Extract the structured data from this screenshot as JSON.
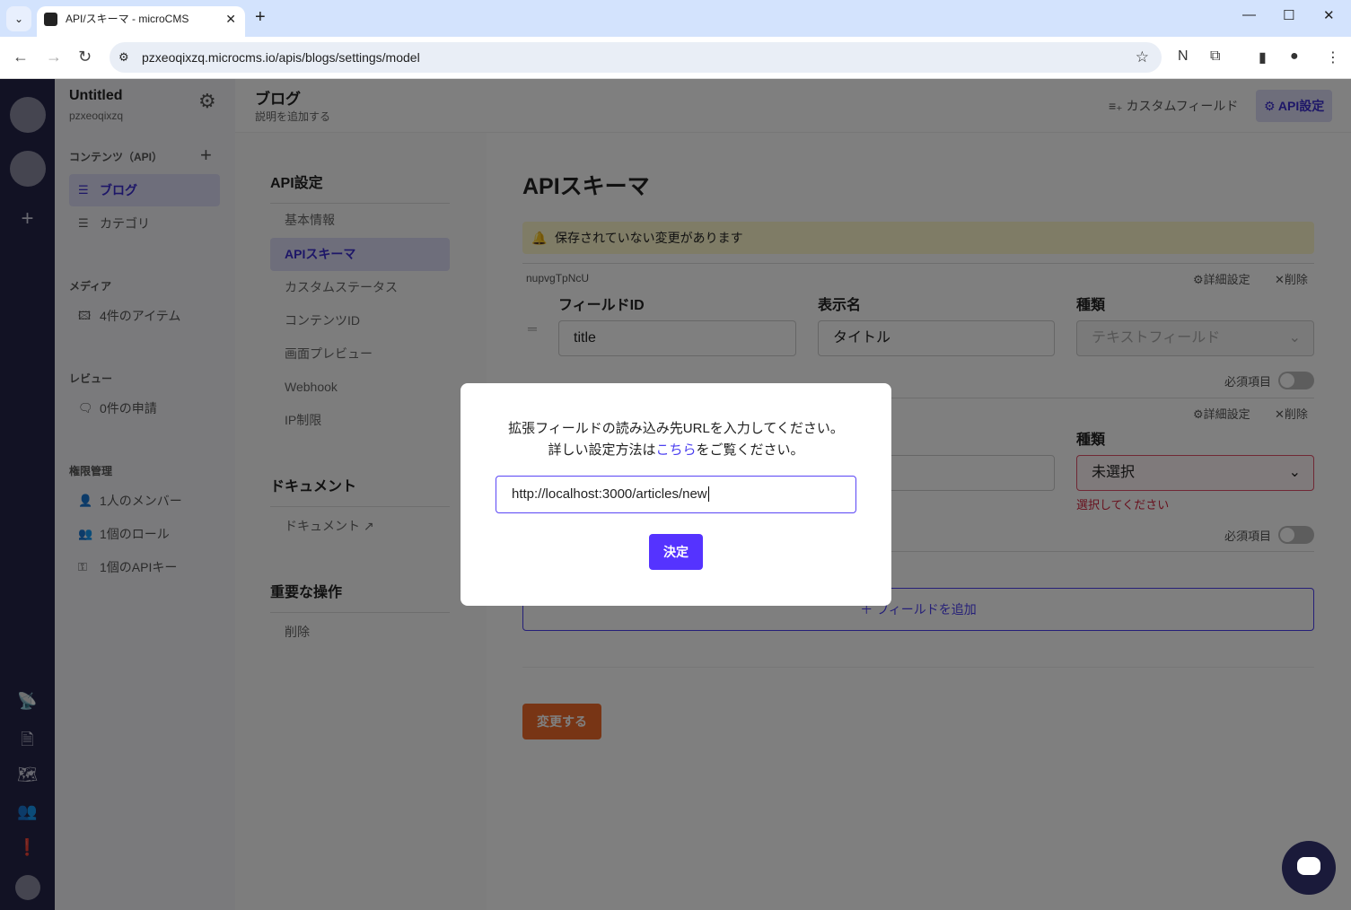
{
  "browser": {
    "tab_title": "API/スキーマ - microCMS",
    "url": "pzxeoqixzq.microcms.io/apis/blogs/settings/model"
  },
  "service": {
    "name": "Untitled",
    "id": "pzxeoqixzq"
  },
  "sidebar": {
    "contents_label": "コンテンツ（API）",
    "apis": [
      {
        "label": "ブログ"
      },
      {
        "label": "カテゴリ"
      }
    ],
    "media_label": "メディア",
    "media_item": "4件のアイテム",
    "review_label": "レビュー",
    "review_item": "0件の申請",
    "perm_label": "権限管理",
    "perm_items": [
      {
        "label": "1人のメンバー"
      },
      {
        "label": "1個のロール"
      },
      {
        "label": "1個のAPIキー"
      }
    ]
  },
  "header": {
    "title": "ブログ",
    "subtitle": "説明を追加する",
    "custom_field": "カスタムフィールド",
    "api_settings": "API設定"
  },
  "settings_nav": {
    "api_heading": "API設定",
    "items": [
      {
        "label": "基本情報"
      },
      {
        "label": "APIスキーマ"
      },
      {
        "label": "カスタムステータス"
      },
      {
        "label": "コンテンツID"
      },
      {
        "label": "画面プレビュー"
      },
      {
        "label": "Webhook"
      },
      {
        "label": "IP制限"
      }
    ],
    "doc_heading": "ドキュメント",
    "doc_item": "ドキュメント",
    "danger_heading": "重要な操作",
    "delete_item": "削除"
  },
  "main": {
    "title": "APIスキーマ",
    "unsaved": "保存されていない変更があります",
    "field1": {
      "key": "nupvgTpNcU",
      "id_label": "フィールドID",
      "name_label": "表示名",
      "type_label": "種類",
      "id": "title",
      "name": "タイトル",
      "type": "テキストフィールド",
      "required": "必須項目",
      "detail": "詳細設定",
      "delete": "削除"
    },
    "field2": {
      "type_label": "種類",
      "type": "未選択",
      "error": "選択してください",
      "required": "必須項目",
      "detail": "詳細設定",
      "delete": "削除"
    },
    "add_field": "＋ フィールドを追加",
    "save": "変更する"
  },
  "modal": {
    "line1": "拡張フィールドの読み込み先URLを入力してください。",
    "line2_pre": "詳しい設定方法は",
    "line2_link": "こちら",
    "line2_post": "をご覧ください。",
    "url": "http://localhost:3000/articles/new",
    "ok": "決定"
  }
}
